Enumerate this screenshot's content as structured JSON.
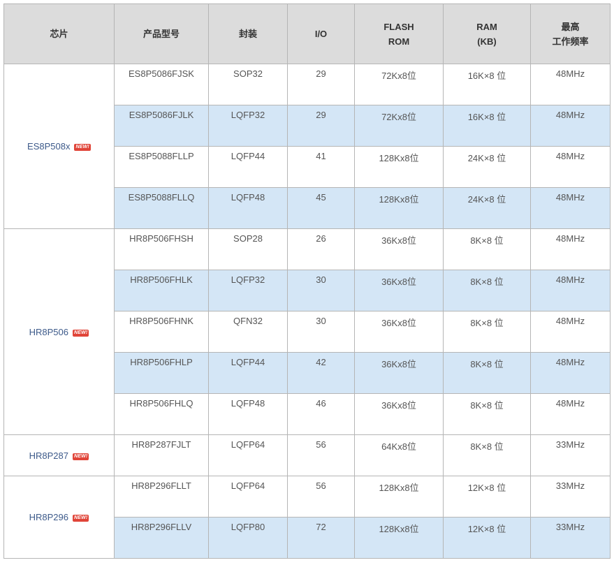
{
  "headers": {
    "chip": "芯片",
    "model": "产品型号",
    "package": "封装",
    "io": "I/O",
    "flash_l1": "FLASH",
    "flash_l2": "ROM",
    "ram_l1": "RAM",
    "ram_l2": "(KB)",
    "freq_l1": "最高",
    "freq_l2": "工作频率"
  },
  "badge": "NEW!",
  "colors": {
    "header_bg": "#dcdcdc",
    "alt_row_bg": "#d4e6f6",
    "chip_text": "#3d5a8a",
    "badge_bg": "#e04438"
  },
  "groups": [
    {
      "chip": "ES8P508x",
      "rows": [
        {
          "model": "ES8P5086FJSK",
          "package": "SOP32",
          "io": "29",
          "flash": "72Kx8位",
          "ram": "16K×8 位",
          "freq": "48MHz"
        },
        {
          "model": "ES8P5086FJLK",
          "package": "LQFP32",
          "io": "29",
          "flash": "72Kx8位",
          "ram": "16K×8 位",
          "freq": "48MHz"
        },
        {
          "model": "ES8P5088FLLP",
          "package": "LQFP44",
          "io": "41",
          "flash": "128Kx8位",
          "ram": "24K×8 位",
          "freq": "48MHz"
        },
        {
          "model": "ES8P5088FLLQ",
          "package": "LQFP48",
          "io": "45",
          "flash": "128Kx8位",
          "ram": "24K×8 位",
          "freq": "48MHz"
        }
      ]
    },
    {
      "chip": "HR8P506",
      "rows": [
        {
          "model": "HR8P506FHSH",
          "package": "SOP28",
          "io": "26",
          "flash": "36Kx8位",
          "ram": "8K×8 位",
          "freq": "48MHz"
        },
        {
          "model": "HR8P506FHLK",
          "package": "LQFP32",
          "io": "30",
          "flash": "36Kx8位",
          "ram": "8K×8 位",
          "freq": "48MHz"
        },
        {
          "model": "HR8P506FHNK",
          "package": "QFN32",
          "io": "30",
          "flash": "36Kx8位",
          "ram": "8K×8 位",
          "freq": "48MHz"
        },
        {
          "model": "HR8P506FHLP",
          "package": "LQFP44",
          "io": "42",
          "flash": "36Kx8位",
          "ram": "8K×8 位",
          "freq": "48MHz"
        },
        {
          "model": "HR8P506FHLQ",
          "package": "LQFP48",
          "io": "46",
          "flash": "36Kx8位",
          "ram": "8K×8 位",
          "freq": "48MHz"
        }
      ]
    },
    {
      "chip": "HR8P287",
      "rows": [
        {
          "model": "HR8P287FJLT",
          "package": "LQFP64",
          "io": "56",
          "flash": "64Kx8位",
          "ram": "8K×8 位",
          "freq": "33MHz"
        }
      ]
    },
    {
      "chip": "HR8P296",
      "rows": [
        {
          "model": "HR8P296FLLT",
          "package": "LQFP64",
          "io": "56",
          "flash": "128Kx8位",
          "ram": "12K×8 位",
          "freq": "33MHz"
        },
        {
          "model": "HR8P296FLLV",
          "package": "LQFP80",
          "io": "72",
          "flash": "128Kx8位",
          "ram": "12K×8 位",
          "freq": "33MHz"
        }
      ]
    }
  ]
}
